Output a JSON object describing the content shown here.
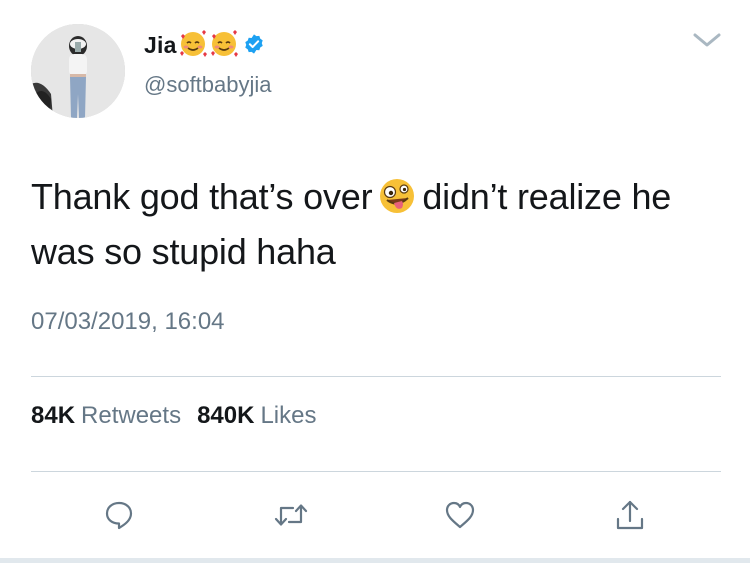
{
  "user": {
    "display_name": "Jia",
    "name_emojis": [
      "smiling-face-with-hearts-emoji",
      "smiling-face-with-hearts-emoji"
    ],
    "verified_icon": "verified-badge-icon",
    "handle": "@softbabyjia"
  },
  "tweet": {
    "text_part1": "Thank god that’s over",
    "inline_emoji": "zany-face-emoji",
    "text_part2": "didn’t realize he was so stupid haha",
    "timestamp": "07/03/2019, 16:04"
  },
  "stats": {
    "retweets_count": "84K",
    "retweets_label": "Retweets",
    "likes_count": "840K",
    "likes_label": "Likes"
  },
  "actions": [
    "reply-icon",
    "retweet-icon",
    "like-icon",
    "share-icon"
  ],
  "colors": {
    "text_primary": "#14171a",
    "text_secondary": "#657786",
    "accent": "#1da1f2",
    "divider": "#ccd6dd",
    "icon": "#657786"
  }
}
